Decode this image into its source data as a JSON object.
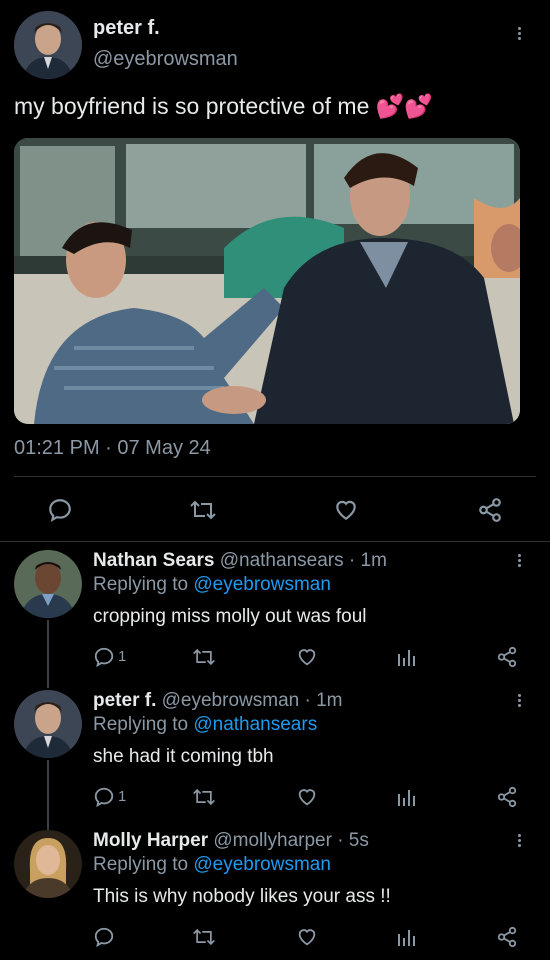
{
  "main_tweet": {
    "author_name": "peter f.",
    "author_handle": "@eyebrowsman",
    "text": "my boyfriend is so protective of me",
    "emoji": "💕💕",
    "timestamp": "01:21 PM · 07 May 24"
  },
  "replies": [
    {
      "name": "Nathan Sears",
      "handle": "@nathansears",
      "time": "· 1m",
      "replying_label": "Replying to",
      "replying_to": "@eyebrowsman",
      "text": "cropping miss molly out was foul",
      "reply_count": "1"
    },
    {
      "name": "peter f.",
      "handle": "@eyebrowsman",
      "time": "· 1m",
      "replying_label": "Replying to",
      "replying_to": "@nathansears",
      "text": "she had it coming tbh",
      "reply_count": "1"
    },
    {
      "name": "Molly Harper",
      "handle": "@mollyharper",
      "time": "· 5s",
      "replying_label": "Replying to",
      "replying_to": "@eyebrowsman",
      "text": "This is why nobody likes your ass !!",
      "reply_count": ""
    }
  ],
  "colors": {
    "background": "#000000",
    "text": "#e7e9ea",
    "muted": "#8b98a5",
    "link": "#1d9bf0"
  }
}
